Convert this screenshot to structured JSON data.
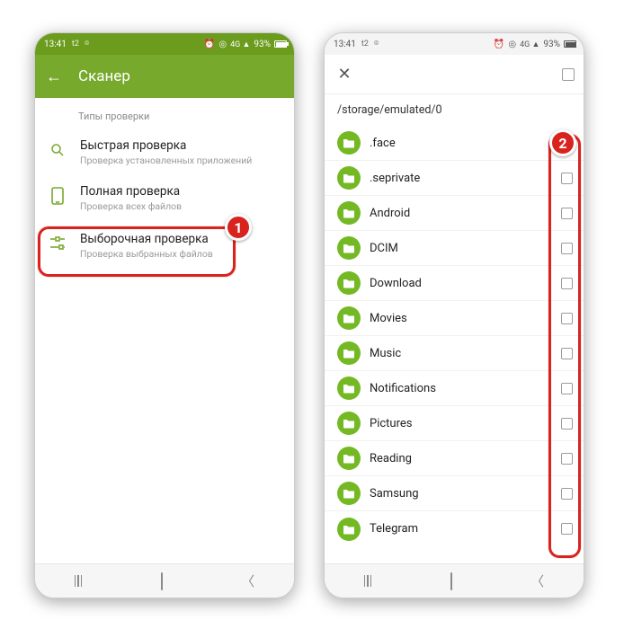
{
  "status": {
    "time": "13:41",
    "left_extra": "t2",
    "battery_pct": "93%"
  },
  "left": {
    "appbar_title": "Сканер",
    "section": "Типы проверки",
    "items": [
      {
        "title": "Быстрая проверка",
        "sub": "Проверка установленных приложений"
      },
      {
        "title": "Полная проверка",
        "sub": "Проверка всех файлов"
      },
      {
        "title": "Выборочная проверка",
        "sub": "Проверка выбранных файлов"
      }
    ]
  },
  "right": {
    "path": "/storage/emulated/0",
    "folders": [
      {
        "name": ".face"
      },
      {
        "name": ".seprivate"
      },
      {
        "name": "Android"
      },
      {
        "name": "DCIM"
      },
      {
        "name": "Download"
      },
      {
        "name": "Movies"
      },
      {
        "name": "Music"
      },
      {
        "name": "Notifications"
      },
      {
        "name": "Pictures"
      },
      {
        "name": "Reading"
      },
      {
        "name": "Samsung"
      },
      {
        "name": "Telegram"
      }
    ]
  },
  "annotations": {
    "badge1": "1",
    "badge2": "2"
  }
}
